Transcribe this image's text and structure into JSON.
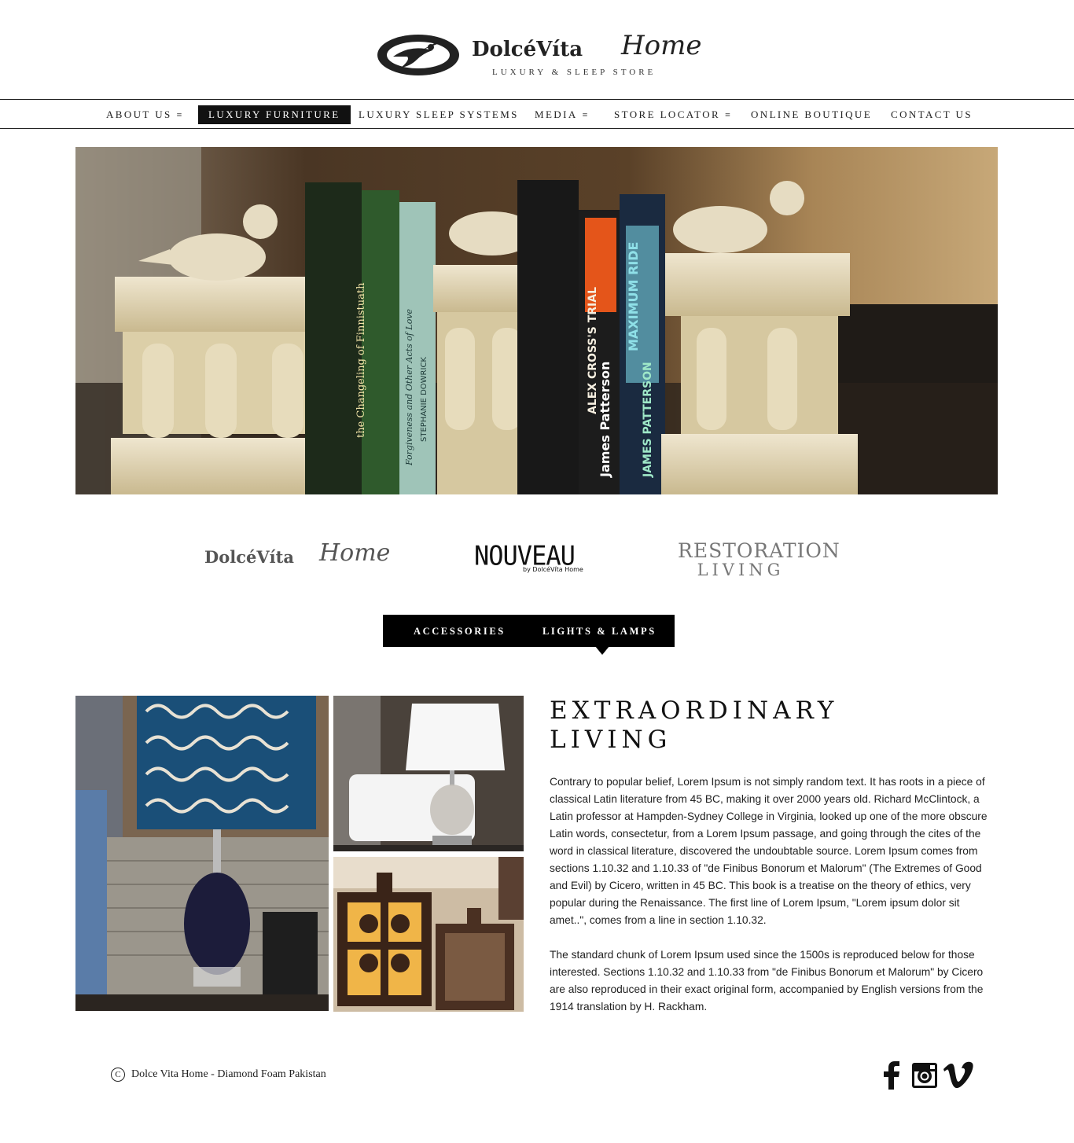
{
  "brand": {
    "name_word": "DolcéVíta",
    "name_script": "Home",
    "tagline": "LUXURY & SLEEP STORE"
  },
  "nav": {
    "items": [
      {
        "label": "ABOUT US",
        "has_menu": true
      },
      {
        "label": "LUXURY FURNITURE",
        "active": true
      },
      {
        "label": "LUXURY SLEEP SYSTEMS"
      },
      {
        "label": "MEDIA",
        "has_menu": true
      },
      {
        "label": "STORE LOCATOR",
        "has_menu": true
      },
      {
        "label": "ONLINE BOUTIQUE"
      },
      {
        "label": "CONTACT US"
      }
    ],
    "menu_glyph": "≡"
  },
  "hero": {
    "books": [
      {
        "title": "the Changeling of Finnistuath",
        "author": ""
      },
      {
        "title": "Forgiveness and Other Acts of Love",
        "author": "STEPHANIE DOWRICK"
      },
      {
        "title": "ALEX CROSS'S TRIAL",
        "author": "James Patterson"
      },
      {
        "title": "MAXIMUM RIDE",
        "author": "JAMES PATTERSON"
      }
    ]
  },
  "brands": {
    "dolcevita": {
      "word": "DolcéVíta",
      "script": "Home"
    },
    "nouveau": {
      "word": "NOUVEAU",
      "sub": "by DolcéVíta Home"
    },
    "restoration": {
      "line1": "RESTORATION",
      "line2": "LIVING"
    }
  },
  "categories": {
    "tabs": [
      "ACCESSORIES",
      "LIGHTS & LAMPS"
    ],
    "selected": "LIGHTS & LAMPS"
  },
  "content": {
    "title_line1": "EXTRAORDINARY",
    "title_line2": "LIVING",
    "paragraph1": "Contrary to popular belief, Lorem Ipsum is not simply random text. It has roots in a piece of classical Latin literature from 45 BC, making it over 2000 years old. Richard McClintock, a Latin professor at Hampden-Sydney College in Virginia, looked up one of the more obscure Latin words, consectetur, from a Lorem Ipsum passage, and going through the cites of the word in classical literature, discovered the undoubtable source. Lorem Ipsum comes from sections 1.10.32 and 1.10.33 of \"de Finibus Bonorum et Malorum\" (The Extremes of Good and Evil) by Cicero, written in 45 BC. This book is a treatise on the theory of ethics, very popular during the Renaissance. The first line of Lorem Ipsum, \"Lorem ipsum dolor sit amet..\", comes from a line in section 1.10.32.",
    "paragraph2": "The standard chunk of Lorem Ipsum used since the 1500s is reproduced below for those interested. Sections 1.10.32 and 1.10.33 from \"de Finibus Bonorum et Malorum\" by Cicero are also reproduced in their exact original form, accompanied by English versions from the 1914 translation by H. Rackham."
  },
  "footer": {
    "copyright_symbol": "C",
    "copyright_text": "Dolce Vita Home - Diamond Foam Pakistan",
    "social_icons": [
      "facebook-icon",
      "instagram-icon",
      "vimeo-icon"
    ]
  },
  "colors": {
    "text": "#222222",
    "nav_active_bg": "#111111",
    "tab_bar_bg": "#000000",
    "brand_gray": "#555555"
  }
}
